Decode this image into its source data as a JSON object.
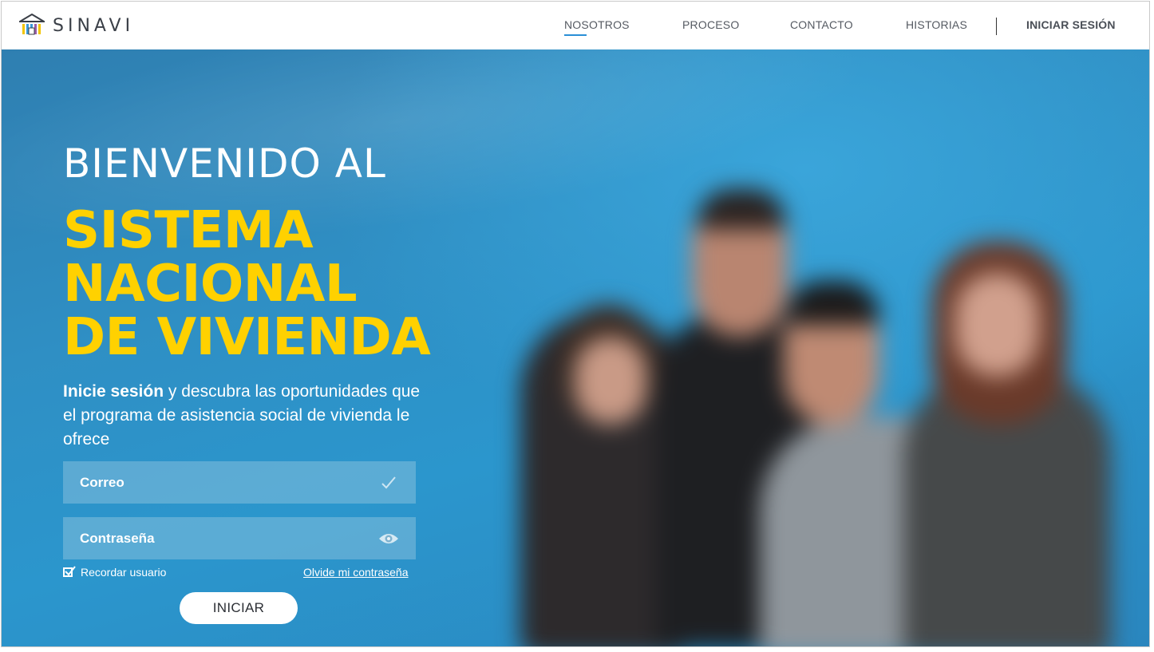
{
  "brand": {
    "name": "SINAVI",
    "logo_icon": "house-bars-icon"
  },
  "nav": {
    "items": [
      {
        "label": "NOSOTROS",
        "active": true
      },
      {
        "label": "PROCESO",
        "active": false
      },
      {
        "label": "CONTACTO",
        "active": false
      },
      {
        "label": "HISTORIAS",
        "active": false
      }
    ],
    "login_label": "INICIAR SESIÓN",
    "accent_color": "#2a8fd6"
  },
  "hero": {
    "welcome": "BIENVENIDO AL",
    "headline_lines": [
      "SISTEMA",
      "NACIONAL",
      "DE VIVIENDA"
    ],
    "headline_color": "#ffd100",
    "intro_bold": "Inicie sesión",
    "intro_rest": " y descubra las oportunidades que el programa de asistencia social de vivienda le ofrece",
    "background_image": "blurred-group-of-four-people"
  },
  "login_form": {
    "email_label": "Correo",
    "email_icon": "check-icon",
    "password_label": "Contraseña",
    "password_icon": "eye-icon",
    "remember_label": "Recordar usuario",
    "remember_checked": true,
    "forgot_label": "Olvide mi contraseña",
    "submit_label": "INICIAR"
  }
}
